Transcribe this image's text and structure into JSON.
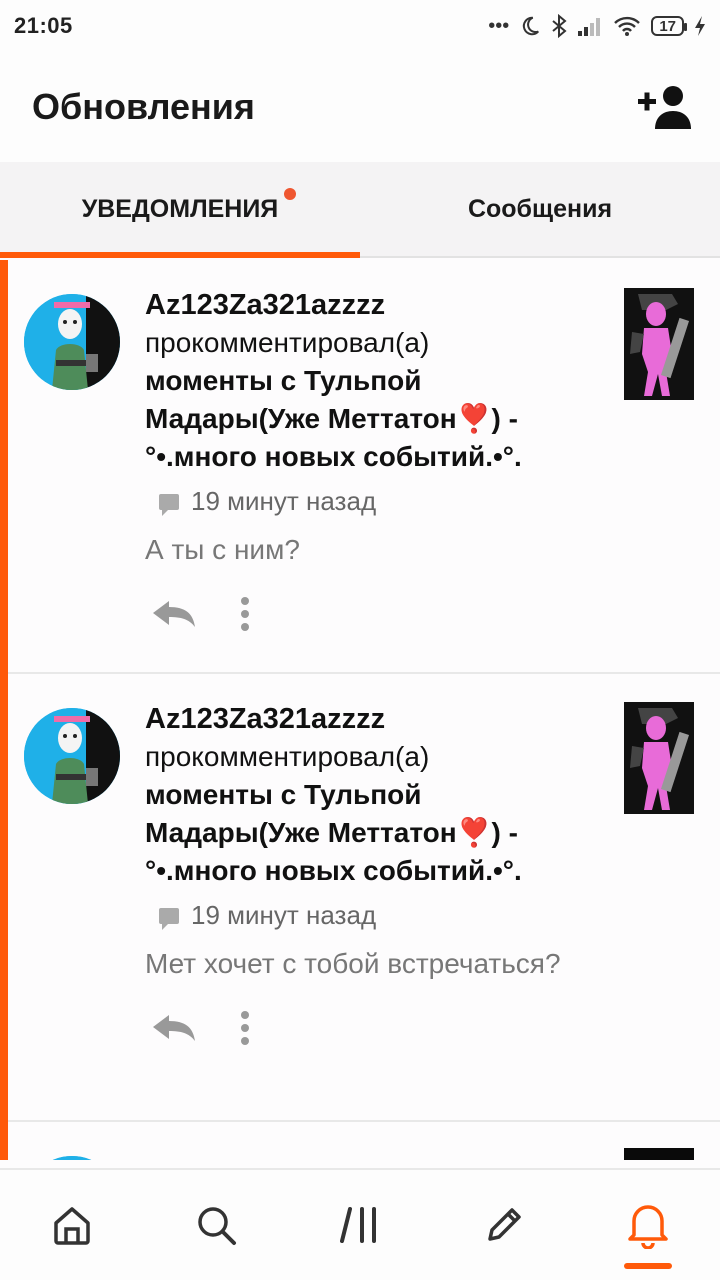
{
  "status_bar": {
    "time": "21:05",
    "battery": "17"
  },
  "app_bar": {
    "title": "Обновления",
    "add_user_icon": "add-user-icon"
  },
  "tabs": [
    {
      "label": "УВЕДОМЛЕНИЯ",
      "active": true,
      "has_dot": true
    },
    {
      "label": "Сообщения",
      "active": false,
      "has_dot": false
    }
  ],
  "notifications": [
    {
      "user": "Az123Za321azzzz",
      "action": "прокомментировал(а)",
      "post_title": "моменты с Тульпой Мадары(Уже Меттатон❣️) - °•.много новых событий.•°.",
      "time": "19 минут назад",
      "comment": "А ты с ним?"
    },
    {
      "user": "Az123Za321azzzz",
      "action": "прокомментировал(а)",
      "post_title": "моменты с Тульпой Мадары(Уже Меттатон❣️) - °•.много новых событий.•°.",
      "time": "19 минут назад",
      "comment": "Мет хочет с тобой встречаться?"
    }
  ],
  "bottom_nav": [
    {
      "icon": "home-icon",
      "active": false
    },
    {
      "icon": "search-icon",
      "active": false
    },
    {
      "icon": "feed-icon",
      "active": false
    },
    {
      "icon": "pencil-icon",
      "active": false
    },
    {
      "icon": "bell-icon",
      "active": true
    }
  ],
  "colors": {
    "accent": "#ff5a0a",
    "dot": "#ef5630"
  }
}
